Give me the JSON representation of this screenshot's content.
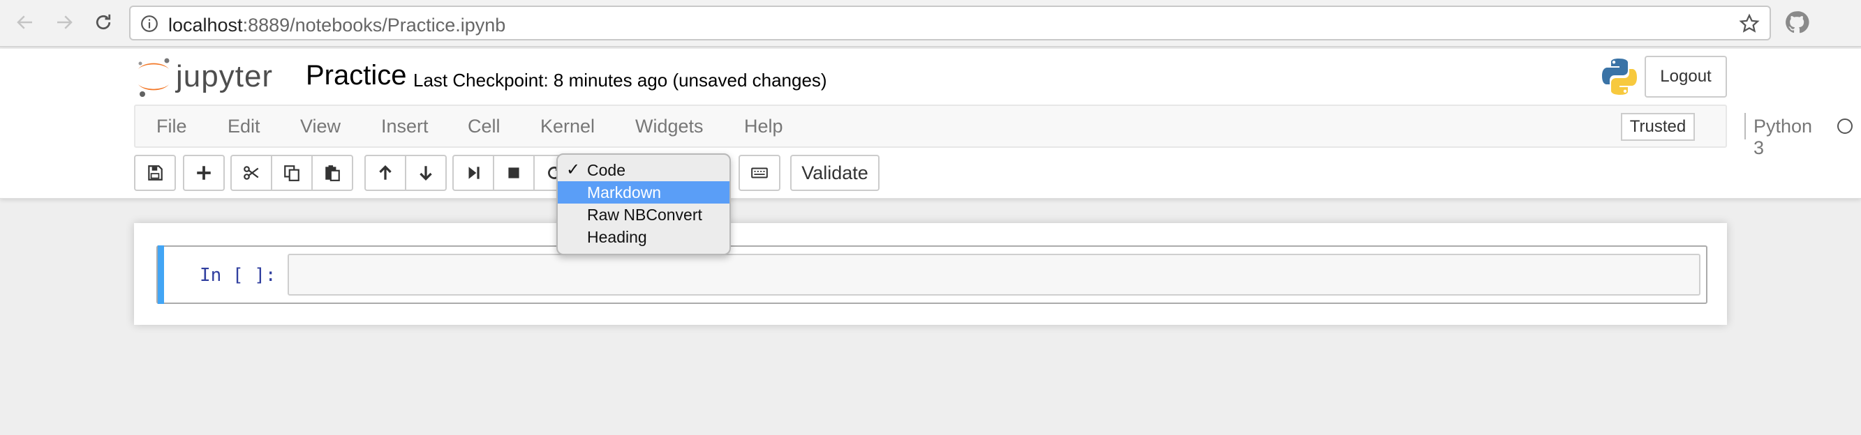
{
  "browser": {
    "url_host": "localhost",
    "url_rest": ":8889/notebooks/Practice.ipynb"
  },
  "header": {
    "logo_text": "jupyter",
    "notebook_name": "Practice",
    "checkpoint_text": "Last Checkpoint: 8 minutes ago (unsaved changes)",
    "logout_label": "Logout"
  },
  "menubar": {
    "items": [
      "File",
      "Edit",
      "View",
      "Insert",
      "Cell",
      "Kernel",
      "Widgets",
      "Help"
    ],
    "trusted_label": "Trusted",
    "kernel_name": "Python 3"
  },
  "toolbar": {
    "validate_label": "Validate"
  },
  "cell_type_dropdown": {
    "options": [
      "Code",
      "Markdown",
      "Raw NBConvert",
      "Heading"
    ],
    "checked": "Code",
    "highlighted": "Markdown",
    "check_glyph": "✓"
  },
  "cell": {
    "prompt": "In [ ]:"
  },
  "colors": {
    "accent": "#42a5f5",
    "selection": "#5a9ef7",
    "jupyter_orange": "#f37726",
    "prompt_blue": "#303f9f"
  }
}
